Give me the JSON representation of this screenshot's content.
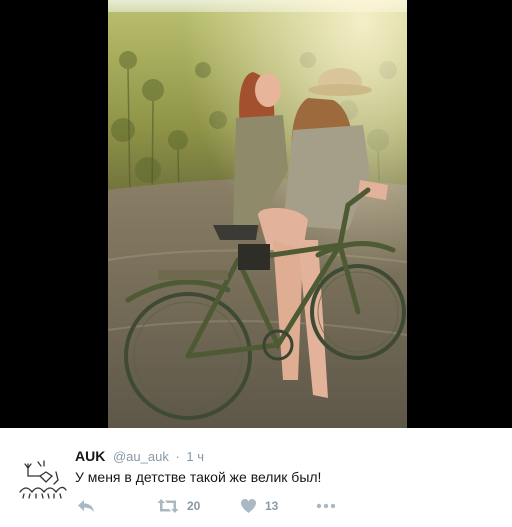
{
  "tweet": {
    "display_name": "AUK",
    "handle": "@au_auk",
    "separator": "·",
    "time": "1 ч",
    "text": "У меня в детстве такой же велик был!"
  },
  "actions": {
    "retweet_count": "20",
    "like_count": "13"
  },
  "icons": {
    "reply": "reply-icon",
    "retweet": "retweet-icon",
    "like": "heart-icon",
    "more": "more-dots-icon",
    "avatar": "deer-sketch-avatar"
  },
  "colors": {
    "icon_gray": "#aab8c2",
    "text_gray": "#8899a6",
    "text_dark": "#14171a",
    "backdrop": "#000000"
  }
}
